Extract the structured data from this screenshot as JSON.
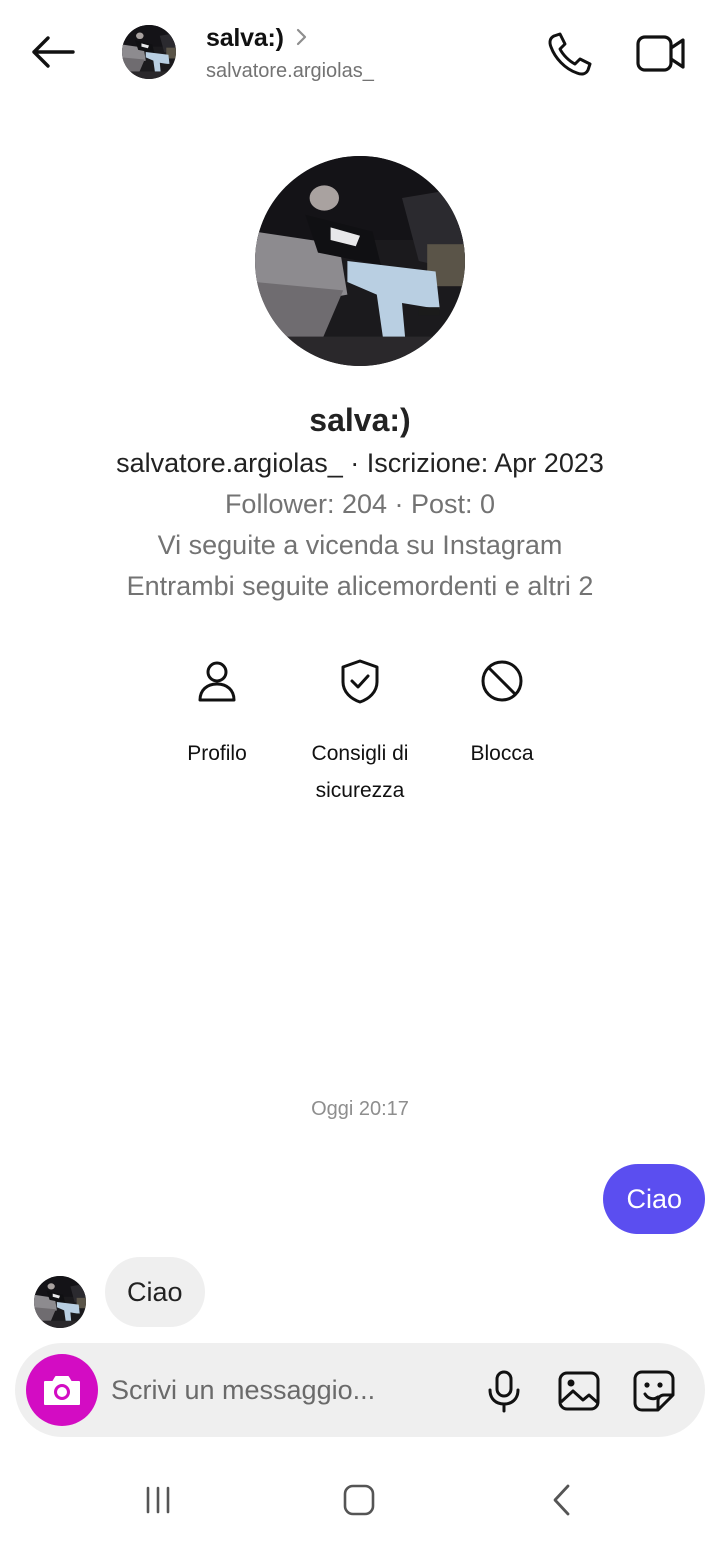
{
  "header": {
    "name": "salva:)",
    "username": "salvatore.argiolas_",
    "icons": [
      "back-arrow-icon",
      "chevron-right-icon",
      "phone-icon",
      "video-camera-icon"
    ]
  },
  "profile": {
    "name": "salva:)",
    "line1": "salvatore.argiolas_ · Iscrizione: Apr 2023",
    "line2": "Follower: 204 · Post: 0",
    "line3": "Vi seguite a vicenda su Instagram",
    "line4": "Entrambi seguite alicemordenti e altri 2",
    "actions": [
      {
        "label": "Profilo",
        "icon": "person-icon"
      },
      {
        "label": "Consigli di sicurezza",
        "icon": "shield-check-icon"
      },
      {
        "label": "Blocca",
        "icon": "block-icon"
      }
    ]
  },
  "chat": {
    "timestamp": "Oggi 20:17",
    "messages": [
      {
        "direction": "outgoing",
        "text": "Ciao"
      },
      {
        "direction": "incoming",
        "text": "Ciao"
      }
    ]
  },
  "composer": {
    "placeholder": "Scrivi un messaggio...",
    "icons": [
      "camera-icon",
      "microphone-icon",
      "gallery-icon",
      "sticker-icon"
    ]
  },
  "navbar": {
    "icons": [
      "recent-apps-icon",
      "home-icon",
      "back-icon"
    ]
  },
  "colors": {
    "accent_bubble": "#5b4ef0",
    "camera_button": "#d30cc3",
    "secondary_text": "#737373",
    "incoming_bubble": "#efefef"
  }
}
